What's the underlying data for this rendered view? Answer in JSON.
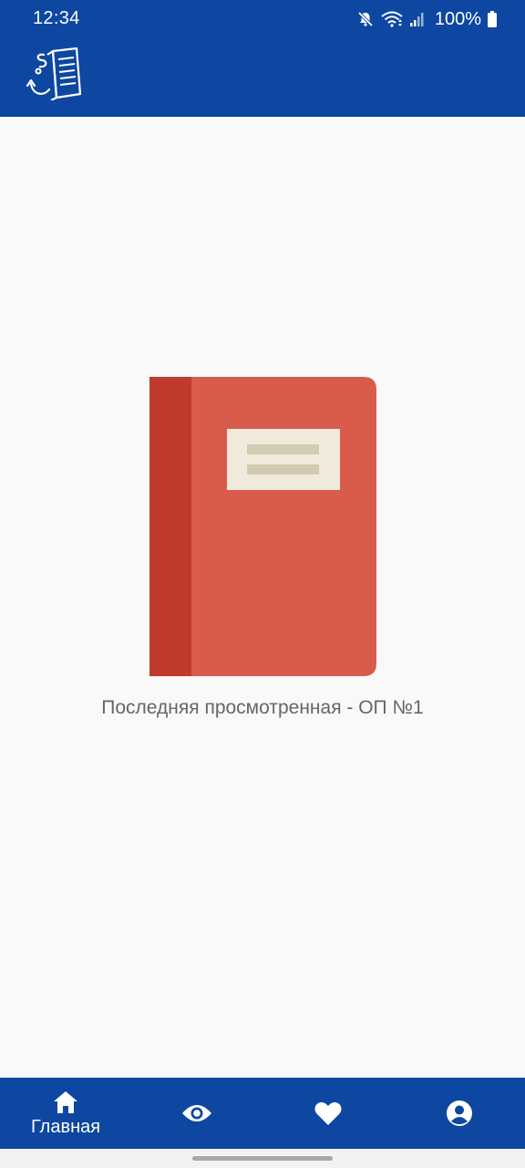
{
  "status_bar": {
    "time": "12:34",
    "battery": "100%",
    "icons": [
      "mute-icon",
      "wifi-icon",
      "signal-icon",
      "battery-icon"
    ]
  },
  "header": {
    "logo_icon": "document-logo-icon",
    "color": "#0D47A1"
  },
  "main": {
    "illustration_icon": "red-book-icon",
    "last_viewed": "Последняя просмотренная - ОП №1"
  },
  "bottom_nav": {
    "items": [
      {
        "icon": "home-icon",
        "label": "Главная",
        "active": true
      },
      {
        "icon": "eye-icon",
        "label": ""
      },
      {
        "icon": "heart-icon",
        "label": ""
      },
      {
        "icon": "account-icon",
        "label": ""
      }
    ]
  },
  "colors": {
    "primary": "#0D47A1",
    "background": "#F9F9F9",
    "book_cover": "#D95B4C",
    "book_spine": "#BF3A2D",
    "book_label": "#EFEADB",
    "book_label_lines": "#D2CBB2"
  }
}
